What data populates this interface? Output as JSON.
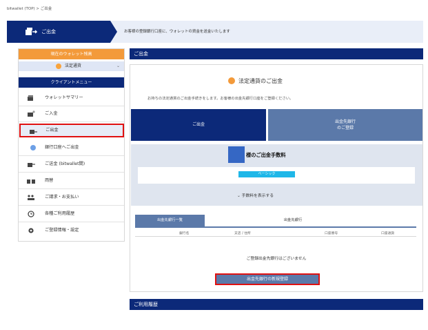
{
  "breadcrumb": "bitwallet (TOP)  >  ご出金",
  "header": {
    "title": "ご出金",
    "description": "お客様の登録銀行口座に、ウォレットの資金を送金いたします"
  },
  "sidebar": {
    "balance_heading": "現在のウォレット残高",
    "currency_selected": "法定通貨",
    "menu_heading": "クライアントメニュー",
    "items": [
      {
        "label": "ウォレットサマリー",
        "icon": "wallet-icon"
      },
      {
        "label": "ご入金",
        "icon": "deposit-icon"
      },
      {
        "label": "ご出金",
        "icon": "withdraw-icon"
      },
      {
        "label": "銀行口座へご出金",
        "icon": "coin-icon"
      },
      {
        "label": "ご送金 (bitwallet間)",
        "icon": "transfer-icon"
      },
      {
        "label": "両替",
        "icon": "exchange-icon"
      },
      {
        "label": "ご請求・お支払い",
        "icon": "billing-icon"
      },
      {
        "label": "各種ご利用履歴",
        "icon": "history-icon"
      },
      {
        "label": "ご登録情報・設定",
        "icon": "gear-icon"
      }
    ]
  },
  "main": {
    "heading": "ご出金",
    "section_title": "法定通貨のご出金",
    "section_desc": "お持ちの法定通貨のご出金手続きをします。お客様の出金先銀行口座をご登録ください。",
    "tile_withdraw": "ご出金",
    "tile_register_line1": "出金先銀行",
    "tile_register_line2": "のご登録",
    "fee_title": "様のご出金手数料",
    "fee_badge": "ベーシック",
    "fee_toggle": "手数料を表示する",
    "tabs": [
      "出金先銀行一覧",
      "出金先銀行"
    ],
    "table_headers": [
      "銀行名",
      "支店 / 住所",
      "口座番号",
      "口座通貨"
    ],
    "empty_message": "ご登録出金先銀行はございません",
    "new_button": "出金先銀行の新規登録",
    "history_heading": "ご利用履歴"
  },
  "colors": {
    "navy": "#0c2979",
    "steel_blue": "#5b79a9",
    "orange": "#f39a3a",
    "highlight_red": "#e01010",
    "cyan_badge": "#1fb7e8"
  }
}
